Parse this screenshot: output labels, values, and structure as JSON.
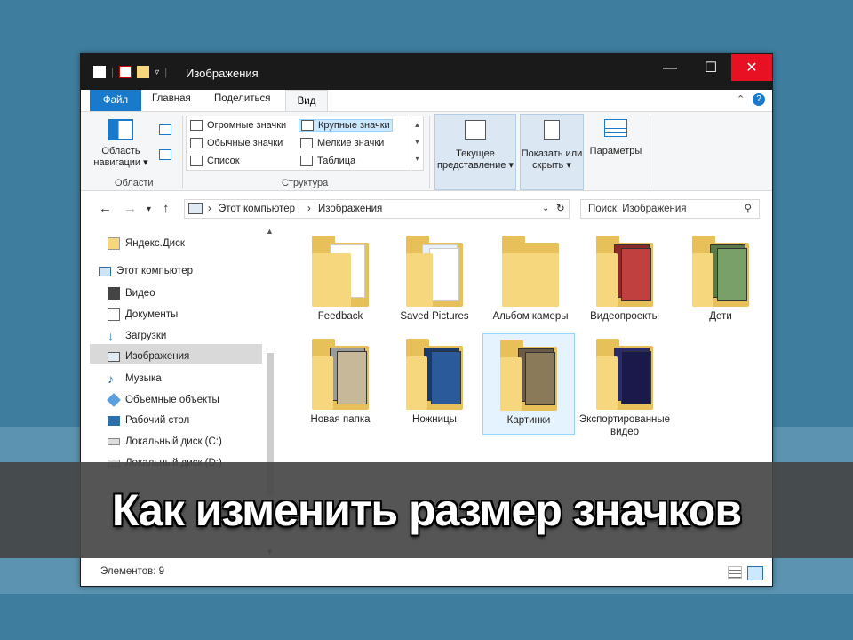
{
  "window": {
    "title": "Изображения",
    "min_symbol": "—",
    "max_symbol": "☐",
    "close_symbol": "✕"
  },
  "menu": {
    "file": "Файл",
    "home": "Главная",
    "share": "Поделиться",
    "view": "Вид"
  },
  "ribbon": {
    "nav_pane_label": "Область навигации",
    "panes_group": "Области",
    "layout_group": "Структура",
    "layout_items": [
      "Огромные значки",
      "Крупные значки",
      "Обычные значки",
      "Мелкие значки",
      "Список",
      "Таблица"
    ],
    "current_view": "Текущее представление",
    "show_hide": "Показать или скрыть",
    "options": "Параметры"
  },
  "address": {
    "path_root": "Этот компьютер",
    "path_current": "Изображения",
    "search_placeholder": "Поиск: Изображения"
  },
  "nav": {
    "items": [
      "Яндекс.Диск",
      "Этот компьютер",
      "Видео",
      "Документы",
      "Загрузки",
      "Изображения",
      "Музыка",
      "Объемные объекты",
      "Рабочий стол",
      "Локальный диск (C:)",
      "Локальный диск (D:)"
    ]
  },
  "files": [
    "Feedback",
    "Saved Pictures",
    "Альбом камеры",
    "Видеопроекты",
    "Дети",
    "Новая папка",
    "Ножницы",
    "Картинки",
    "Экспортированные видео"
  ],
  "status": {
    "items_count": "Элементов: 9"
  },
  "banner": {
    "text": "Как изменить размер значков"
  },
  "colors": {
    "accent": "#1979ca",
    "folder": "#f6d77e",
    "close_button": "#e81123"
  }
}
